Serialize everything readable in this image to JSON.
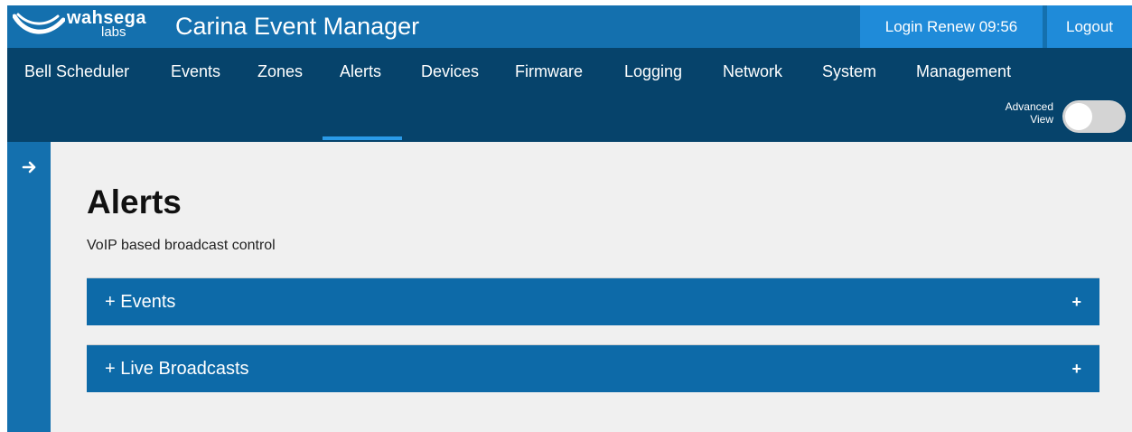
{
  "header": {
    "logo_line1": "wahsega",
    "logo_line2": "labs",
    "app_title": "Carina Event Manager",
    "login_renew": "Login Renew 09:56",
    "logout": "Logout"
  },
  "nav": {
    "items": [
      "Bell Scheduler",
      "Events",
      "Zones",
      "Alerts",
      "Devices",
      "Firmware",
      "Logging",
      "Network",
      "System",
      "Management"
    ],
    "active": "Alerts",
    "advanced_view_line1": "Advanced",
    "advanced_view_line2": "View",
    "advanced_view_on": false
  },
  "sidebar": {
    "toggle_icon": "arrow-right-icon"
  },
  "main": {
    "title": "Alerts",
    "subtitle": "VoIP based broadcast control",
    "panels": [
      {
        "label": "+ Events",
        "expand": "+"
      },
      {
        "label": "+ Live Broadcasts",
        "expand": "+"
      }
    ]
  },
  "colors": {
    "topbar": "#1470ae",
    "buttons": "#1f8bd9",
    "navbar": "#06436b",
    "active_underline": "#2a9be8",
    "panel": "#0d6aa8",
    "background": "#f0f0f0"
  }
}
